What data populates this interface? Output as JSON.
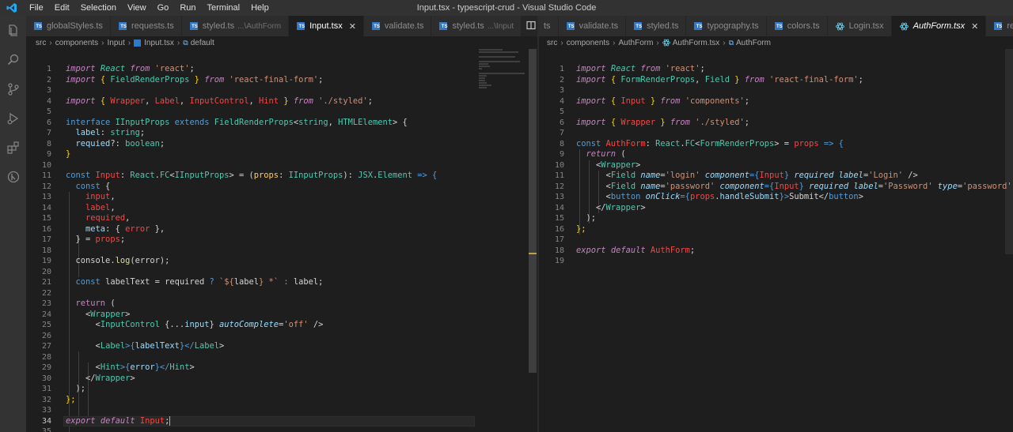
{
  "titlebar": {
    "menu": [
      "File",
      "Edit",
      "Selection",
      "View",
      "Go",
      "Run",
      "Terminal",
      "Help"
    ],
    "title": "Input.tsx - typescript-crud - Visual Studio Code"
  },
  "activity_icons": [
    "explorer-icon",
    "search-icon",
    "source-control-icon",
    "run-debug-icon",
    "extensions-icon",
    "remote-icon"
  ],
  "left": {
    "tabs": [
      {
        "label": "globalStyles.ts",
        "desc": ""
      },
      {
        "label": "requests.ts",
        "desc": ""
      },
      {
        "label": "styled.ts",
        "desc": "...\\AuthForm"
      },
      {
        "label": "Input.tsx",
        "desc": "",
        "active": true,
        "close": "✕"
      },
      {
        "label": "validate.ts",
        "desc": ""
      },
      {
        "label": "styled.ts",
        "desc": "...\\Input"
      }
    ],
    "breadcrumb": [
      "src",
      "components",
      "Input",
      "Input.tsx",
      "default"
    ],
    "line_numbers": [
      "1",
      "2",
      "3",
      "4",
      "5",
      "6",
      "7",
      "8",
      "9",
      "10",
      "11",
      "12",
      "13",
      "14",
      "15",
      "16",
      "17",
      "18",
      "19",
      "20",
      "21",
      "22",
      "23",
      "24",
      "25",
      "26",
      "27",
      "28",
      "29",
      "30",
      "31",
      "32",
      "33",
      "34",
      "35"
    ]
  },
  "right": {
    "tabs": [
      {
        "label": "ts",
        "desc": ""
      },
      {
        "label": "validate.ts",
        "desc": ""
      },
      {
        "label": "styled.ts",
        "desc": ""
      },
      {
        "label": "typography.ts",
        "desc": ""
      },
      {
        "label": "colors.ts",
        "desc": ""
      },
      {
        "label": "Login.tsx",
        "desc": "",
        "react": true
      },
      {
        "label": "AuthForm.tsx",
        "desc": "",
        "active": true,
        "react": true,
        "close": "✕"
      },
      {
        "label": "red",
        "desc": ""
      }
    ],
    "breadcrumb": [
      "src",
      "components",
      "AuthForm",
      "AuthForm.tsx",
      "AuthForm"
    ],
    "line_numbers": [
      "1",
      "2",
      "3",
      "4",
      "5",
      "6",
      "7",
      "8",
      "9",
      "10",
      "11",
      "12",
      "13",
      "14",
      "15",
      "16",
      "17",
      "18",
      "19"
    ]
  },
  "code": {
    "input": {
      "l1": [
        "import",
        "React",
        "from",
        "'react'",
        ";"
      ],
      "l2": [
        "import",
        "{ ",
        "FieldRenderProps",
        " } ",
        "from",
        "'react-final-form'",
        ";"
      ],
      "l4": [
        "import",
        "{ ",
        "Wrapper",
        ", ",
        "Label",
        ", ",
        "InputControl",
        ", ",
        "Hint",
        " } ",
        "from",
        "'./styled'",
        ";"
      ],
      "l6": [
        "interface",
        "IInputProps",
        "extends",
        "FieldRenderProps",
        "<",
        "string",
        ", ",
        "HTMLElement",
        "> {"
      ],
      "l7": [
        "label",
        ": ",
        "string",
        ";"
      ],
      "l8": [
        "requied",
        "?: ",
        "boolean",
        ";"
      ],
      "l9": [
        "}"
      ],
      "l11": [
        "const",
        "Input",
        ": ",
        "React",
        ".",
        "FC",
        "<",
        "IInputProps",
        "> = (",
        "props",
        ": ",
        "IInputProps",
        "): ",
        "JSX",
        ".",
        "Element",
        " => {"
      ],
      "l12": [
        "const",
        " {"
      ],
      "l13": [
        "input",
        ","
      ],
      "l14": [
        "label",
        ","
      ],
      "l15": [
        "required",
        ","
      ],
      "l16": [
        "meta",
        ": { ",
        "error",
        " },"
      ],
      "l17": [
        "} = ",
        "props",
        ";"
      ],
      "l19": [
        "console",
        ".",
        "log",
        "(error);"
      ],
      "l21": [
        "const",
        "labelText",
        " = ",
        "required",
        " ? ",
        "`${",
        "label",
        "} *`",
        " : ",
        "label",
        ";"
      ],
      "l23": [
        "return",
        " ("
      ],
      "l24": [
        "<",
        "Wrapper",
        ">"
      ],
      "l25": [
        "<",
        "InputControl",
        " {",
        "...",
        "input",
        "} ",
        "autoComplete",
        "=",
        "'off'",
        " />"
      ],
      "l27": [
        "<",
        "Label",
        ">{",
        "labelText",
        "}</",
        "Label",
        ">"
      ],
      "l29": [
        "<",
        "Hint",
        ">{",
        "error",
        "}</",
        "Hint",
        ">"
      ],
      "l30": [
        "</",
        "Wrapper",
        ">"
      ],
      "l31": [
        ");"
      ],
      "l32": [
        "};"
      ],
      "l34": [
        "export",
        "default",
        "Input",
        ";"
      ]
    },
    "auth": {
      "l1": [
        "import",
        "React",
        "from",
        "'react'",
        ";"
      ],
      "l2": [
        "import",
        "{ ",
        "FormRenderProps",
        ", ",
        "Field",
        " } ",
        "from",
        "'react-final-form'",
        ";"
      ],
      "l4": [
        "import",
        "{ ",
        "Input",
        " } ",
        "from",
        "'components'",
        ";"
      ],
      "l6": [
        "import",
        "{ ",
        "Wrapper",
        " } ",
        "from",
        "'./styled'",
        ";"
      ],
      "l8": [
        "const",
        "AuthForm",
        ": ",
        "React",
        ".",
        "FC",
        "<",
        "FormRenderProps",
        "> = ",
        "props",
        " => {"
      ],
      "l9": [
        "return",
        " ("
      ],
      "l10": [
        "<",
        "Wrapper",
        ">"
      ],
      "l11": [
        "<",
        "Field",
        " ",
        "name",
        "=",
        "'login'",
        " ",
        "component",
        "={",
        "Input",
        "} ",
        "required",
        " ",
        "label",
        "=",
        "'Login'",
        " />"
      ],
      "l12": [
        "<",
        "Field",
        " ",
        "name",
        "=",
        "'password'",
        " ",
        "component",
        "={",
        "Input",
        "} ",
        "required",
        " ",
        "label",
        "=",
        "'Password'",
        " ",
        "type",
        "=",
        "'password'",
        " />"
      ],
      "l13": [
        "<",
        "button",
        " ",
        "onClick",
        "={",
        "props",
        ".",
        "handleSubmit",
        "}>",
        "Submit",
        "</",
        "button",
        ">"
      ],
      "l14": [
        "</",
        "Wrapper",
        ">"
      ],
      "l15": [
        ");"
      ],
      "l16": [
        "};"
      ],
      "l18": [
        "export",
        "default",
        "AuthForm",
        ";"
      ]
    }
  }
}
